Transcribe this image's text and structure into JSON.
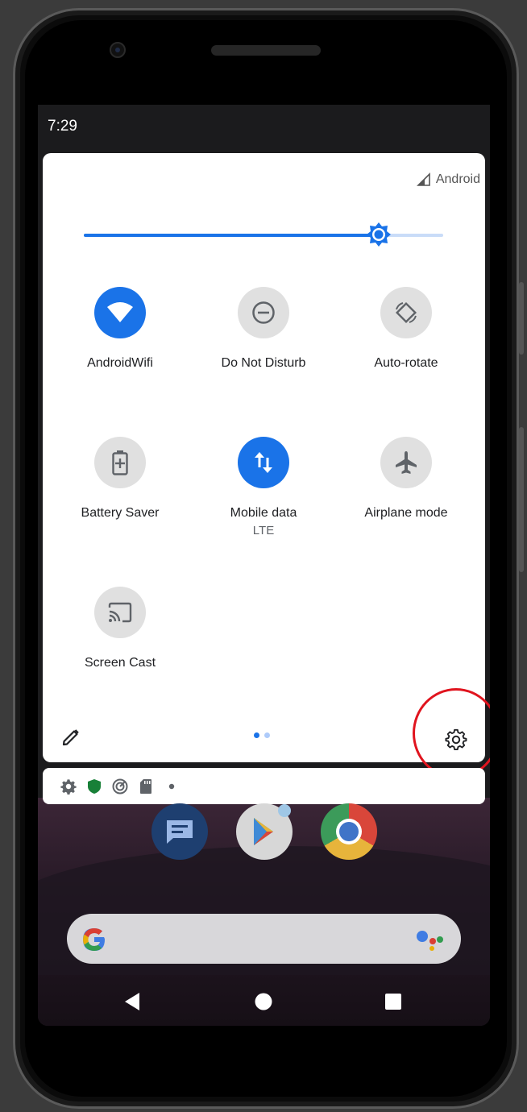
{
  "status_bar": {
    "time": "7:29"
  },
  "quick_settings": {
    "carrier": "Android",
    "brightness_level": 0.82,
    "tiles": [
      {
        "label": "AndroidWifi",
        "sub": "",
        "active": true,
        "icon": "wifi-icon"
      },
      {
        "label": "Do Not Disturb",
        "sub": "",
        "active": false,
        "icon": "do-not-disturb-icon"
      },
      {
        "label": "Auto-rotate",
        "sub": "",
        "active": false,
        "icon": "auto-rotate-icon"
      },
      {
        "label": "Battery Saver",
        "sub": "",
        "active": false,
        "icon": "battery-saver-icon"
      },
      {
        "label": "Mobile data",
        "sub": "LTE",
        "active": true,
        "icon": "mobile-data-icon"
      },
      {
        "label": "Airplane mode",
        "sub": "",
        "active": false,
        "icon": "airplane-icon"
      },
      {
        "label": "Screen Cast",
        "sub": "",
        "active": false,
        "icon": "screen-cast-icon"
      }
    ],
    "page_count": 2,
    "current_page": 1
  },
  "notification_icons": [
    "settings-icon",
    "shield-icon",
    "vpn-icon",
    "sd-card-icon",
    "more-dot-icon"
  ],
  "home": {
    "dock_apps": [
      "messages-app-icon",
      "play-store-app-icon",
      "chrome-app-icon"
    ]
  },
  "colors": {
    "accent": "#1a73e8",
    "tile_off": "#e0e0e0",
    "highlight": "#e0141e"
  }
}
